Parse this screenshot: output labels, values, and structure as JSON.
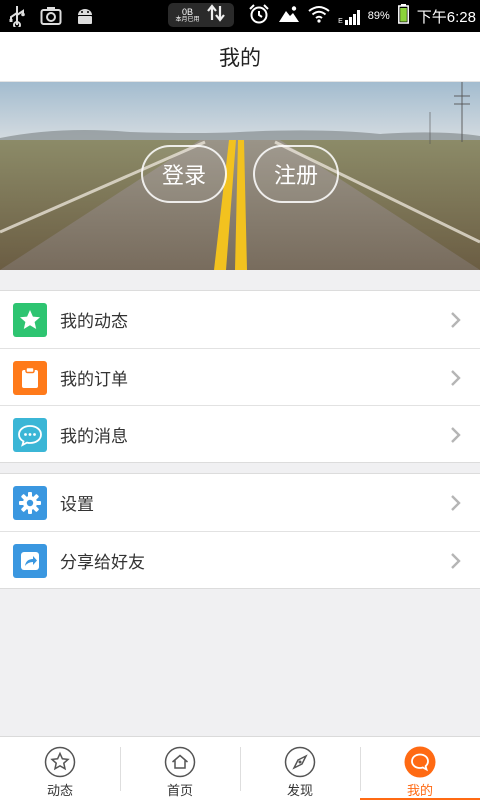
{
  "status_bar": {
    "traffic_amount": "0B",
    "traffic_caption": "本月已用",
    "battery_percent": "89%",
    "time": "下午6:28",
    "network_label": "E"
  },
  "header": {
    "title": "我的"
  },
  "banner": {
    "login_label": "登录",
    "register_label": "注册"
  },
  "menu_group_1": [
    {
      "label": "我的动态",
      "icon": "star-icon",
      "color": "#2ec471"
    },
    {
      "label": "我的订单",
      "icon": "clipboard-icon",
      "color": "#ff7a1a"
    },
    {
      "label": "我的消息",
      "icon": "chat-bubble-icon",
      "color": "#3bb6d6"
    }
  ],
  "menu_group_2": [
    {
      "label": "设置",
      "icon": "gear-icon",
      "color": "#3a97e0"
    },
    {
      "label": "分享给好友",
      "icon": "share-icon",
      "color": "#3a97e0"
    }
  ],
  "tab_bar": {
    "tabs": [
      {
        "label": "动态",
        "icon": "star-outline-icon",
        "active": false
      },
      {
        "label": "首页",
        "icon": "home-icon",
        "active": false
      },
      {
        "label": "发现",
        "icon": "compass-icon",
        "active": false
      },
      {
        "label": "我的",
        "icon": "chat-user-icon",
        "active": true
      }
    ],
    "active_color": "#ff6a13"
  }
}
